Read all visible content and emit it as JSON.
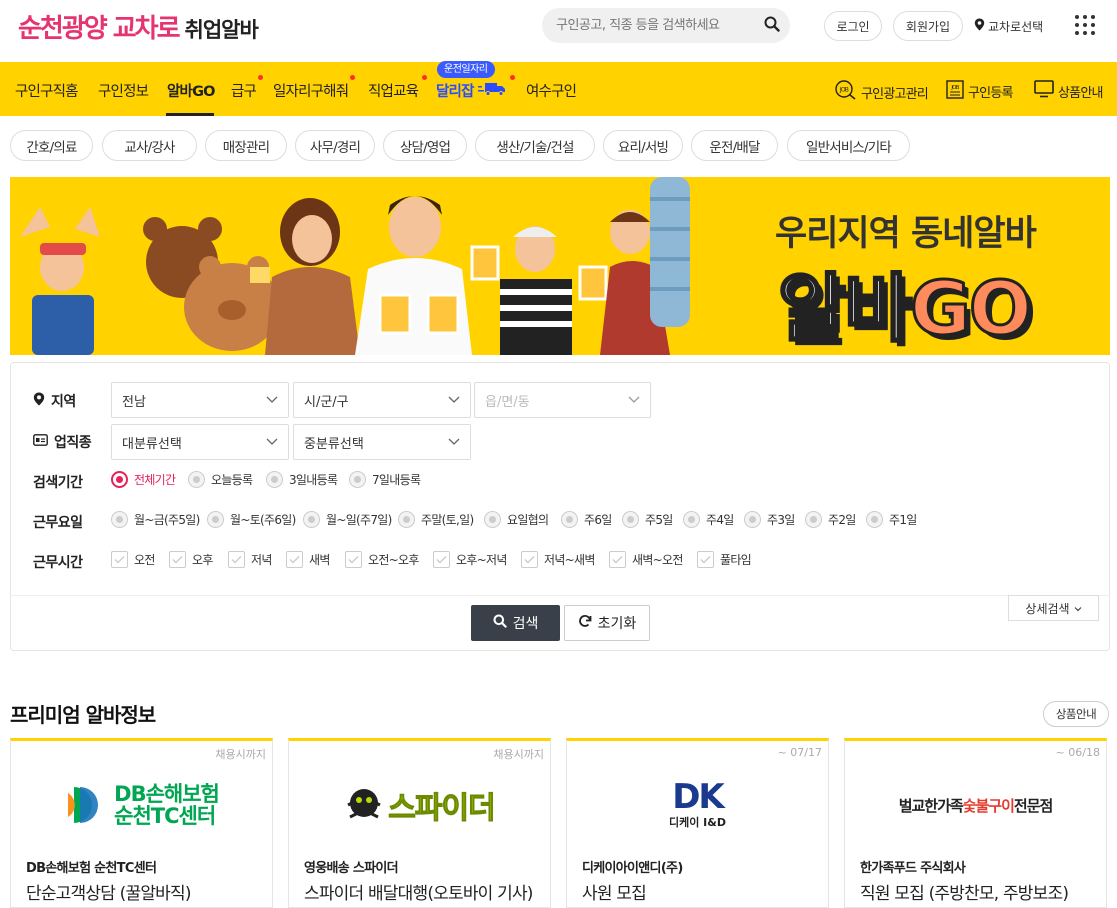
{
  "header": {
    "logo_main": "순천광양 교차로",
    "logo_sub": "취업알바",
    "search_placeholder": "구인공고, 직종 등을 검색하세요",
    "login": "로그인",
    "signup": "회원가입",
    "region_select": "교차로선택"
  },
  "nav": {
    "items": [
      "구인구직홈",
      "구인정보",
      "알바GO",
      "급구",
      "일자리구해줘",
      "직업교육",
      "달리잡",
      "여수구인"
    ],
    "badge": "운전일자리",
    "right": [
      "구인광고관리",
      "구인등록",
      "상품안내"
    ]
  },
  "categories": [
    "간호/의료",
    "교사/강사",
    "매장관리",
    "사무/경리",
    "상담/영업",
    "생산/기술/건설",
    "요리/서빙",
    "운전/배달",
    "일반서비스/기타"
  ],
  "banner": {
    "line1": "우리지역 동네알바",
    "line2_a": "알바",
    "line2_b": "GO"
  },
  "search_form": {
    "region_label": "지역",
    "region_values": [
      "전남",
      "시/군/구",
      "읍/면/동"
    ],
    "job_label": "업직종",
    "job_values": [
      "대분류선택",
      "중분류선택"
    ],
    "period_label": "검색기간",
    "period_options": [
      "전체기간",
      "오늘등록",
      "3일내등록",
      "7일내등록"
    ],
    "period_selected": "전체기간",
    "days_label": "근무요일",
    "days_options": [
      "월~금(주5일)",
      "월~토(주6일)",
      "월~일(주7일)",
      "주말(토,일)",
      "요일협의",
      "주6일",
      "주5일",
      "주4일",
      "주3일",
      "주2일",
      "주1일"
    ],
    "time_label": "근무시간",
    "time_options": [
      "오전",
      "오후",
      "저녁",
      "새벽",
      "오전~오후",
      "오후~저녁",
      "저녁~새벽",
      "새벽~오전",
      "풀타임"
    ],
    "search_button": "검색",
    "reset_button": "초기화",
    "detail_button": "상세검색"
  },
  "premium": {
    "title": "프리미엄 알바정보",
    "guide": "상품안내",
    "cards": [
      {
        "period": "채용시까지",
        "logo_line1": "DB손해보험",
        "logo_line2": "순천TC센터",
        "company": "DB손해보험 순천TC센터",
        "title": "단순고객상담 (꿀알바직)"
      },
      {
        "period": "채용시까지",
        "logo_text": "스파이더",
        "company": "영웅배송 스파이더",
        "title": "스파이더 배달대행(오토바이 기사)"
      },
      {
        "period": "~ 07/17",
        "logo_text": "DK",
        "logo_sub": "디케이 I&D",
        "company": "디케이아이앤디(주)",
        "title": "사원 모집"
      },
      {
        "period": "~ 06/18",
        "logo_text_a": "벌교한가족",
        "logo_text_b": "숯불구이",
        "logo_text_c": "전문점",
        "company": "한가족푸드 주식회사",
        "title": "직원 모집 (주방찬모, 주방보조)"
      }
    ]
  },
  "colors": {
    "brand_pink": "#e5346f",
    "nav_yellow": "#ffd200",
    "accent_red": "#e5235a",
    "badge_blue": "#3b5bff",
    "search_btn": "#3a4049"
  }
}
